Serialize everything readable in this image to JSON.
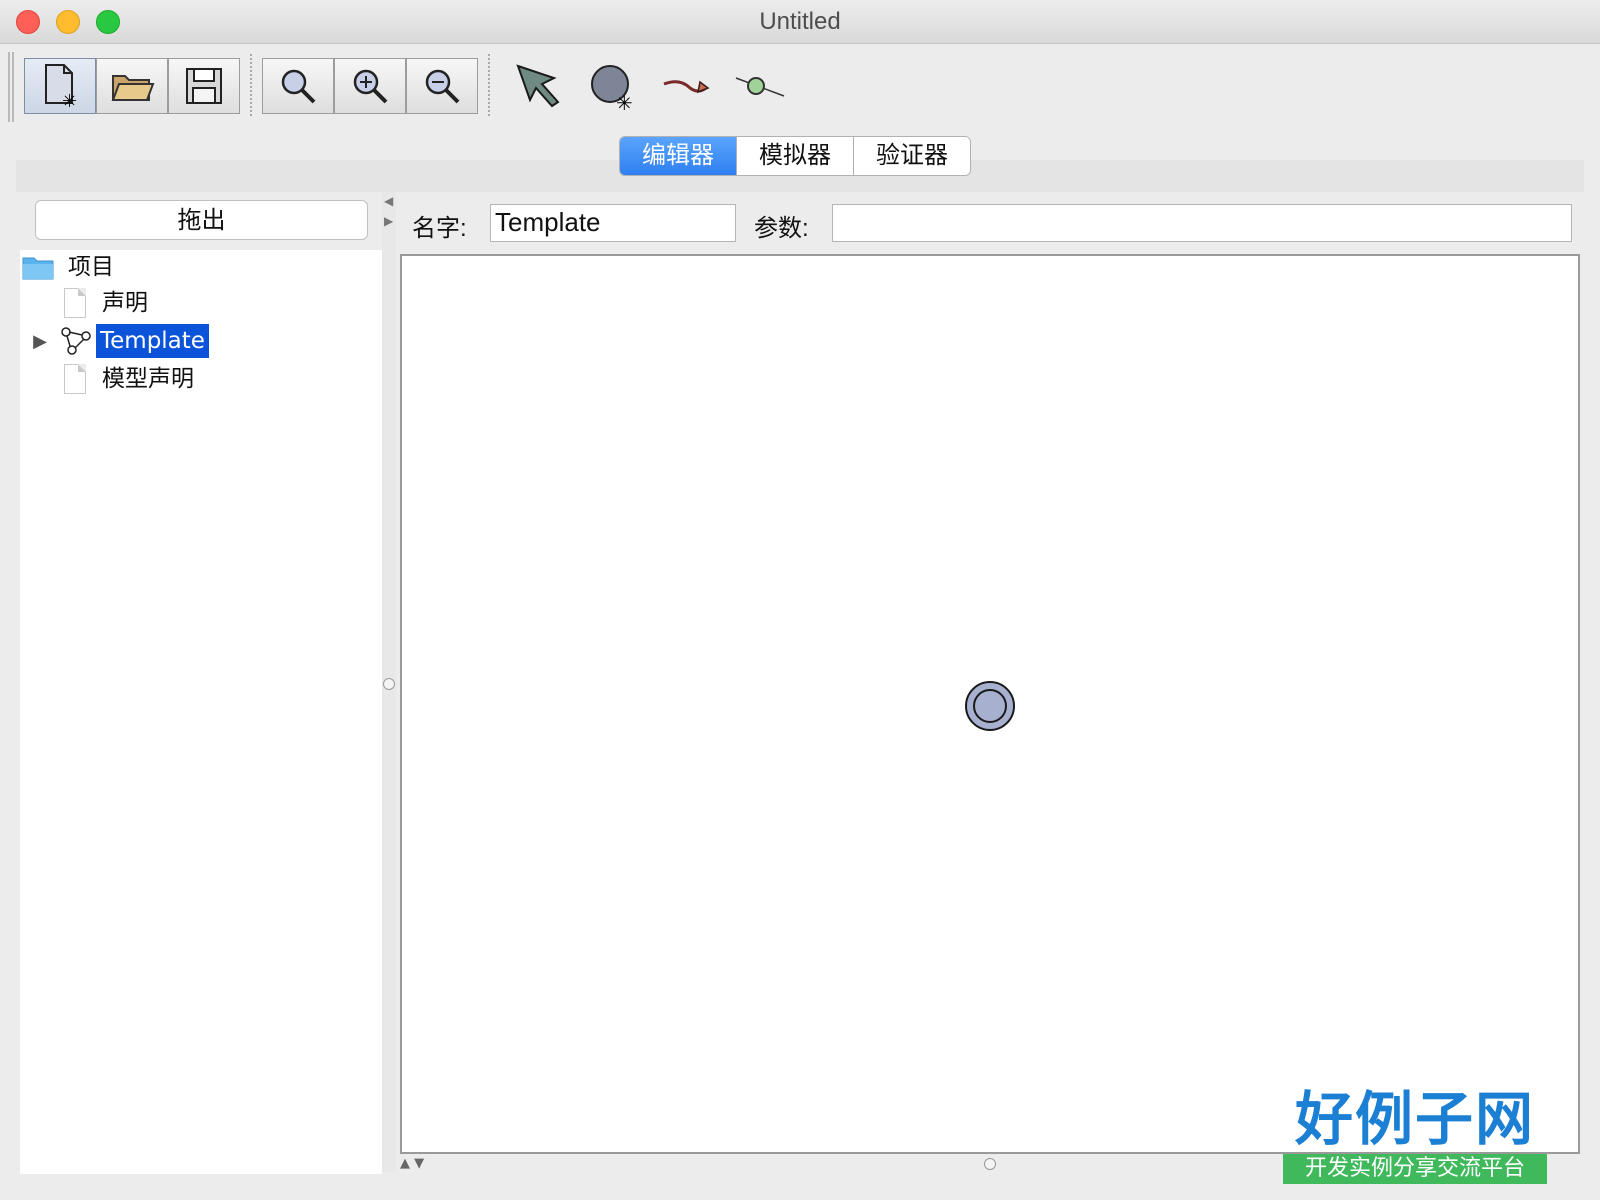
{
  "window": {
    "title": "Untitled"
  },
  "toolbar": {
    "file_buttons": [
      {
        "name": "new-document-button",
        "icon": "new-document-icon"
      },
      {
        "name": "open-folder-button",
        "icon": "open-folder-icon"
      },
      {
        "name": "save-button",
        "icon": "save-disk-icon"
      }
    ],
    "zoom_buttons": [
      {
        "name": "zoom-fit-button",
        "icon": "magnifier-icon"
      },
      {
        "name": "zoom-in-button",
        "icon": "zoom-in-icon"
      },
      {
        "name": "zoom-out-button",
        "icon": "zoom-out-icon"
      }
    ],
    "edit_tools": [
      {
        "name": "select-tool",
        "icon": "select-arrow-icon"
      },
      {
        "name": "add-location-tool",
        "icon": "add-location-icon"
      },
      {
        "name": "add-edge-tool",
        "icon": "add-edge-icon"
      },
      {
        "name": "add-nail-tool",
        "icon": "add-nail-icon"
      }
    ]
  },
  "tabs": [
    {
      "label": "编辑器",
      "active": true
    },
    {
      "label": "模拟器",
      "active": false
    },
    {
      "label": "验证器",
      "active": false
    }
  ],
  "left_panel": {
    "drag_button": "拖出",
    "tree": {
      "root": "项目",
      "items": [
        {
          "label": "声明",
          "icon": "document-icon",
          "selected": false
        },
        {
          "label": "Template",
          "icon": "template-automaton-icon",
          "selected": true
        },
        {
          "label": "模型声明",
          "icon": "document-icon",
          "selected": false
        }
      ]
    }
  },
  "editor": {
    "name_label": "名字:",
    "name_value": "Template",
    "params_label": "参数:",
    "params_value": ""
  },
  "branding": {
    "title": "好例子网",
    "subtitle": "开发实例分享交流平台"
  },
  "colors": {
    "active_tab": "#2f7ff2",
    "selection": "#0b53d8",
    "location_fill": "#a8b0d0",
    "brand_blue": "#1b7fd4",
    "brand_green": "#40b85c"
  }
}
